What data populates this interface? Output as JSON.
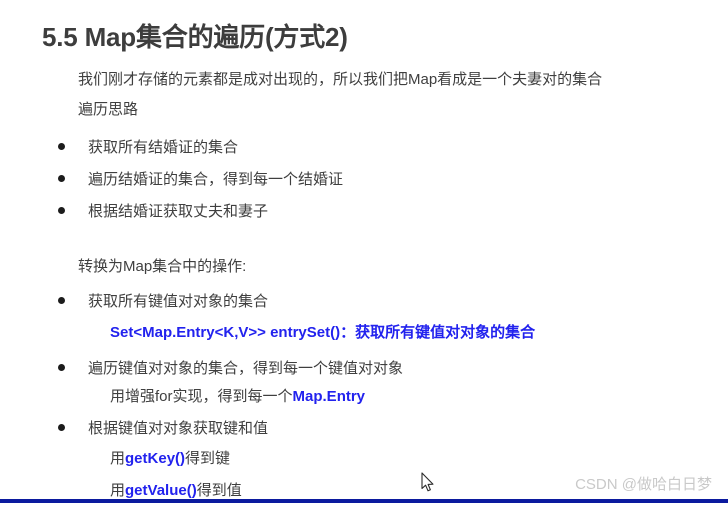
{
  "slide": {
    "title": "5.5 Map集合的遍历(方式2)",
    "paragraph": {
      "line1": "我们刚才存储的元素都是成对出现的，所以我们把Map看成是一个夫妻对的集合",
      "line2": "遍历思路"
    },
    "bullets_concept": [
      "获取所有结婚证的集合",
      "遍历结婚证的集合，得到每一个结婚证",
      "根据结婚证获取丈夫和妻子"
    ],
    "section_lead": "转换为Map集合中的操作:",
    "bullets_code": [
      "获取所有键值对对象的集合",
      "遍历键值对对象的集合，得到每一个键值对对象",
      "根据键值对对象获取键和值"
    ],
    "code_entryset": "Set<Map.Entry<K,V>> entrySet()：获取所有键值对对象的集合",
    "foreach_line": {
      "prefix": "用增强for实现，得到每一个",
      "highlight": "Map.Entry"
    },
    "getkey_line": {
      "prefix": "用",
      "highlight": "getKey()",
      "suffix": "得到键"
    },
    "getvalue_line": {
      "prefix": "用",
      "highlight": "getValue()",
      "suffix": "得到值"
    },
    "watermark": "CSDN @做哈白日梦",
    "colors": {
      "title": "#3d3d3d",
      "body": "#3f3f3f",
      "code_blue": "#2222ee",
      "bottom_bar": "#0b1a9e",
      "watermark": "#c9c9c9"
    }
  }
}
